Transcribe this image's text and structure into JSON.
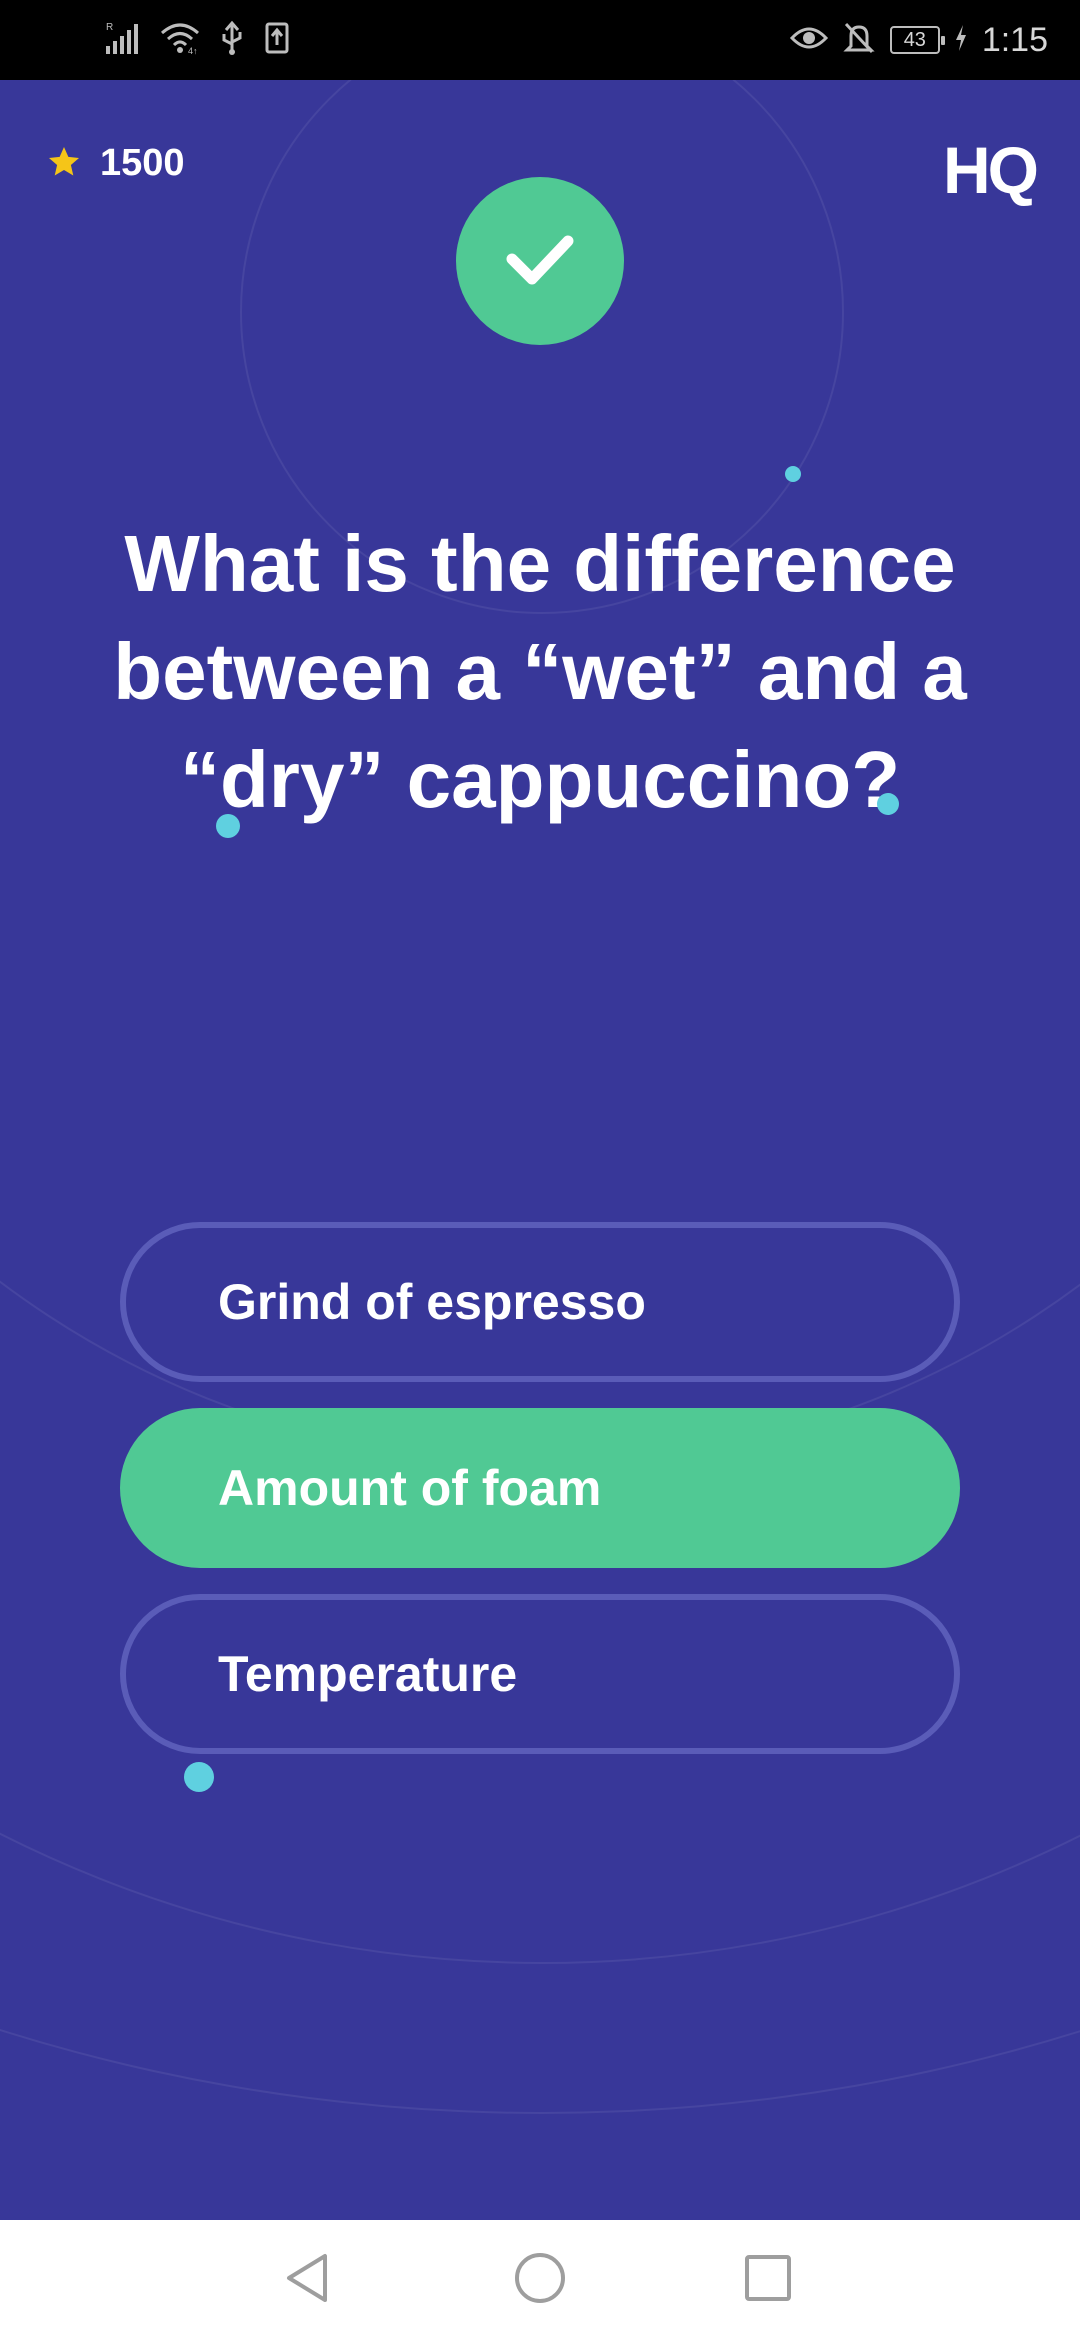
{
  "status_bar": {
    "time": "1:15",
    "battery": "43",
    "icons": [
      "signal-icon",
      "wifi-icon",
      "usb-icon",
      "upload-icon",
      "eye-icon",
      "notifications-off-icon",
      "battery-icon",
      "charging-icon"
    ]
  },
  "game": {
    "score": "1500",
    "logo": "HQ",
    "question": "What is the difference between a “wet” and a “dry” cappuccino?",
    "answers": [
      {
        "label": "Grind of espresso",
        "correct": false
      },
      {
        "label": "Amount of foam",
        "correct": true
      },
      {
        "label": "Temperature",
        "correct": false
      }
    ]
  },
  "navigation": {
    "icons": [
      "back-icon",
      "home-icon",
      "recents-icon"
    ]
  },
  "colors": {
    "background": "#383799",
    "correct": "#50c994",
    "answer_border": "#5a5cb8",
    "star": "#f5c518",
    "accent_dot": "#5fd0e0"
  }
}
